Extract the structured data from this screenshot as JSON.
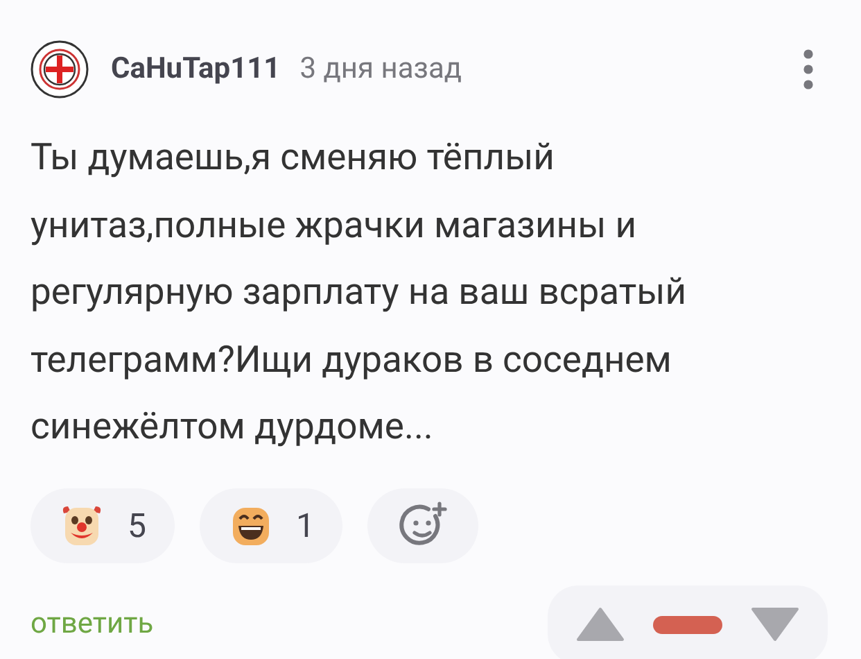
{
  "comment": {
    "author": "СаНuТар111",
    "time": "3 дня назад",
    "text": "Ты думаешь,я сменяю тёплый унитаз,полные жрачки магазины и регулярную зарплату на ваш всратый телеграмм?Ищи дураков в соседнем синежёлтом дурдоме..."
  },
  "reactions": [
    {
      "kind": "clown",
      "count": "5"
    },
    {
      "kind": "grin",
      "count": "1"
    },
    {
      "kind": "add"
    }
  ],
  "reply": "ответить",
  "rating": {
    "color": "#d46152"
  }
}
